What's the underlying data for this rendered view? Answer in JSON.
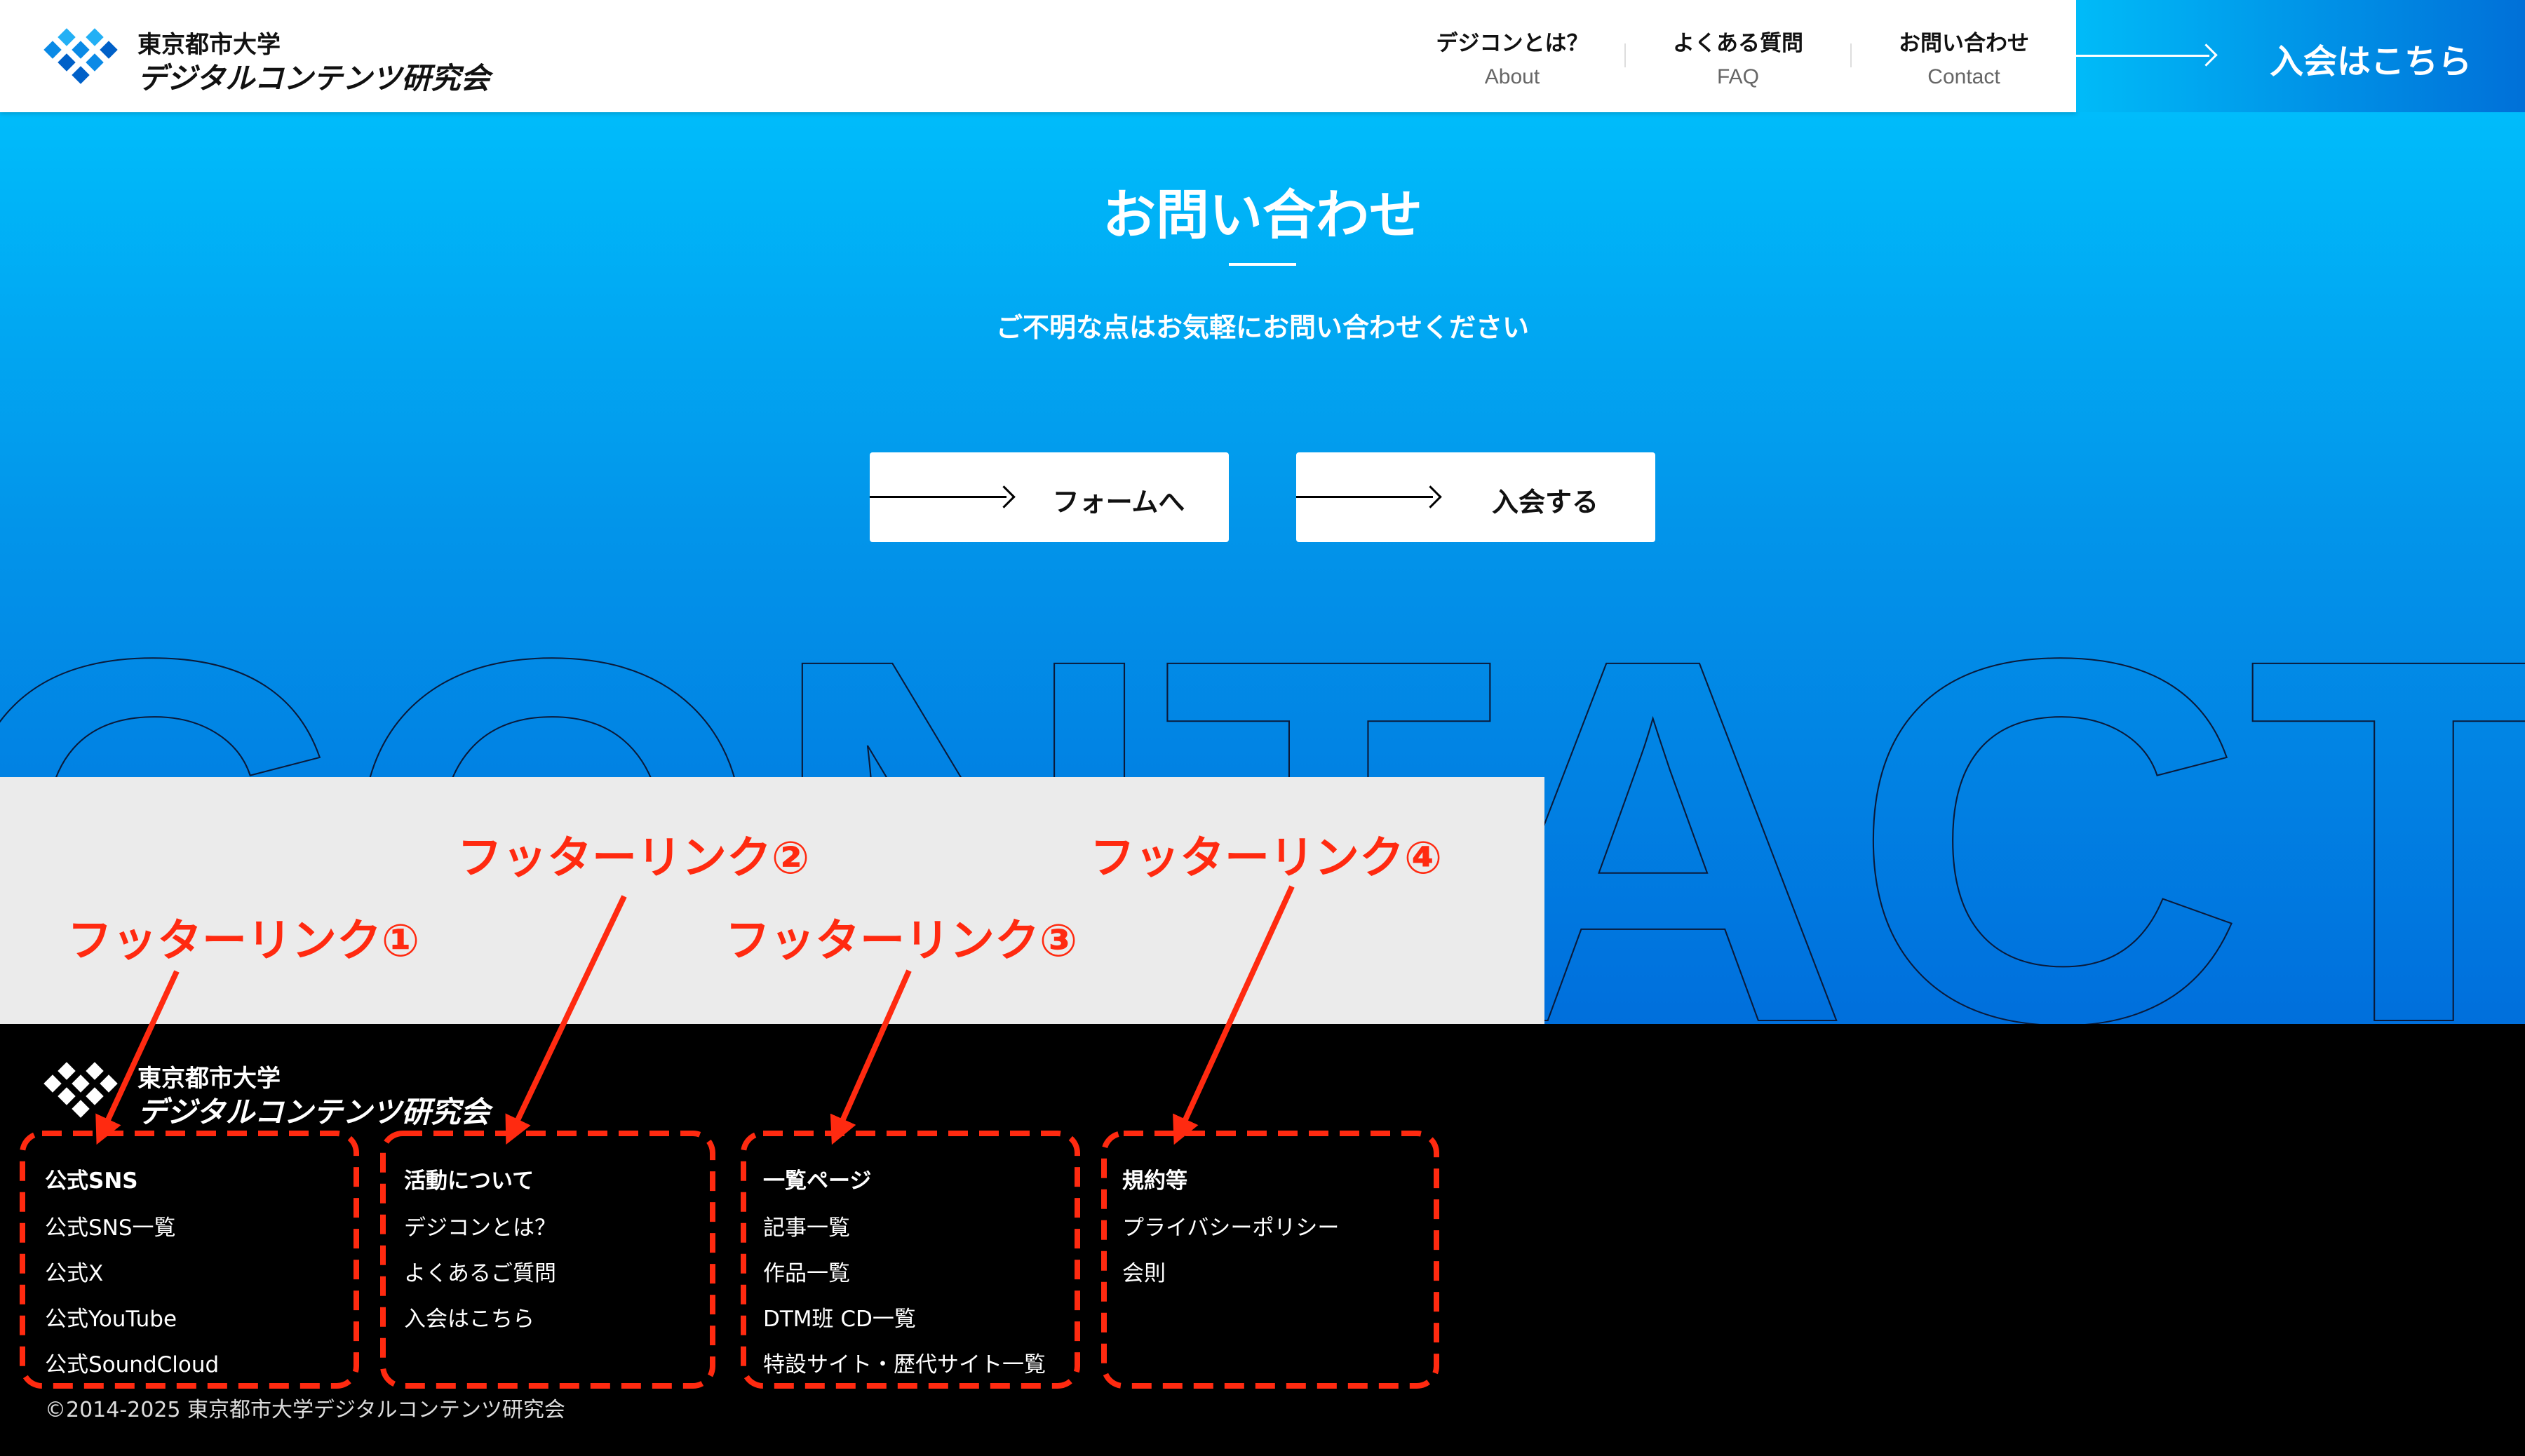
{
  "header": {
    "logo_line1": "東京都市大学",
    "logo_line2": "デジタルコンテンツ研究会",
    "nav": [
      {
        "jp": "デジコンとは？",
        "en": "About"
      },
      {
        "jp": "よくある質問",
        "en": "FAQ"
      },
      {
        "jp": "お問い合わせ",
        "en": "Contact"
      }
    ],
    "join_label": "入会はこちら"
  },
  "contact": {
    "title": "お問い合わせ",
    "subtitle": "ご不明な点はお気軽にお問い合わせください",
    "buttons": [
      "フォームへ",
      "入会する"
    ],
    "background_word": "CONTACT"
  },
  "annotations": [
    "フッターリンク①",
    "フッターリンク②",
    "フッターリンク③",
    "フッターリンク④"
  ],
  "footer": {
    "logo_line1": "東京都市大学",
    "logo_line2": "デジタルコンテンツ研究会",
    "columns": [
      {
        "heading": "公式SNS",
        "items": [
          "公式SNS一覧",
          "公式X",
          "公式YouTube",
          "公式SoundCloud"
        ]
      },
      {
        "heading": "活動について",
        "items": [
          "デジコンとは？",
          "よくあるご質問",
          "入会はこちら"
        ]
      },
      {
        "heading": "一覧ページ",
        "items": [
          "記事一覧",
          "作品一覧",
          "DTM班 CD一覧",
          "特設サイト・歴代サイト一覧"
        ]
      },
      {
        "heading": "規約等",
        "items": [
          "プライバシーポリシー",
          "会則"
        ]
      }
    ],
    "copyright": "©2014-2025 東京都市大学デジタルコンテンツ研究会"
  },
  "colors": {
    "accent_top": "#00bcfb",
    "accent_bottom": "#006fdc",
    "annotation": "#ff2a10"
  }
}
